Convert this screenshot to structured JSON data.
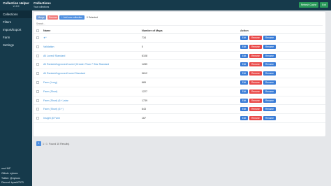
{
  "sidebar": {
    "title": "Collection Helper",
    "version": "v1.0.0",
    "items": [
      {
        "label": "Collections"
      },
      {
        "label": "Filters"
      },
      {
        "label": "Import/Export"
      },
      {
        "label": "Farm"
      },
      {
        "label": "Settings"
      }
    ],
    "footer": [
      "osu! N/F",
      "Github: nyboxs",
      "Twitter: @nyboxs",
      "Discord: byzai#7573"
    ]
  },
  "header": {
    "title": "Collections",
    "subtitle": "Your collections",
    "refresh_label": "Refresh Cache",
    "exit_label": "Exit"
  },
  "toolbar": {
    "merge_label": "Merge",
    "remove_label": "Remove",
    "add_label": "+ Add new collection",
    "selected_text": "0 Selected"
  },
  "search": {
    "placeholder": "Search..."
  },
  "table": {
    "headers": {
      "name": "Name",
      "count": "Number of Maps",
      "action": "Action"
    },
    "edit_label": "Edit",
    "remove_label": "Remove",
    "rename_label": "Rename",
    "rows": [
      {
        "name": "★*",
        "count": "734"
      },
      {
        "name": "Validation",
        "count": "0"
      },
      {
        "name": "All Loved/ Standard",
        "count": "6108"
      },
      {
        "name": "All Ranked/Approved/Loved (Greater Than 7 Star Standard",
        "count": "1289"
      },
      {
        "name": "All Ranked/Approved/Loved Standard",
        "count": "9612"
      },
      {
        "name": "Farm (Long)",
        "count": "689"
      },
      {
        "name": "Farm (Short)",
        "count": "1227"
      },
      {
        "name": "Farm (Short) (6 +) star",
        "count": "1739"
      },
      {
        "name": "Farm (Short) (6 +)",
        "count": "643"
      },
      {
        "name": "Insight (8 Farm",
        "count": "167"
      }
    ]
  },
  "pagination": {
    "current_page": "1",
    "page_info": "1 / 1",
    "results_text": "Found 10 Results)"
  }
}
